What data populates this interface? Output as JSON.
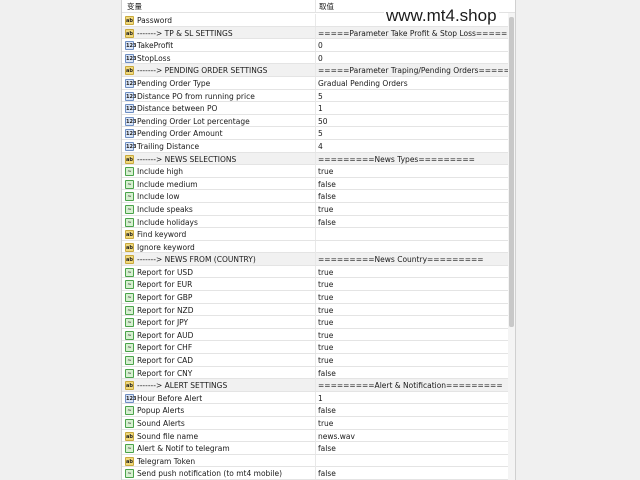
{
  "header": {
    "col_variable": "变量",
    "col_value": "取值"
  },
  "watermark": "www.mt4.shop",
  "rows": [
    {
      "icon": "ab",
      "name": "Password",
      "value": "",
      "sep": false
    },
    {
      "icon": "ab",
      "name": "-------> TP & SL SETTINGS",
      "value": "=====Parameter Take Profit & Stop Loss=====",
      "sep": true
    },
    {
      "icon": "n",
      "name": "TakeProfit",
      "value": "0",
      "sep": false
    },
    {
      "icon": "n",
      "name": "StopLoss",
      "value": "0",
      "sep": false
    },
    {
      "icon": "ab",
      "name": "-------> PENDING ORDER SETTINGS",
      "value": "=====Parameter Traping/Pending Orders=====",
      "sep": true
    },
    {
      "icon": "n",
      "name": "Pending Order Type",
      "value": "Gradual Pending Orders",
      "sep": false
    },
    {
      "icon": "n",
      "name": "Distance PO from running price",
      "value": "5",
      "sep": false
    },
    {
      "icon": "n",
      "name": "Distance between PO",
      "value": "1",
      "sep": false
    },
    {
      "icon": "n",
      "name": "Pending Order Lot percentage",
      "value": "50",
      "sep": false
    },
    {
      "icon": "n",
      "name": "Pending Order Amount",
      "value": "5",
      "sep": false
    },
    {
      "icon": "n",
      "name": "Trailing Distance",
      "value": "4",
      "sep": false
    },
    {
      "icon": "ab",
      "name": "-------> NEWS SELECTIONS",
      "value": "=========News Types=========",
      "sep": true
    },
    {
      "icon": "b",
      "name": "Include high",
      "value": "true",
      "sep": false
    },
    {
      "icon": "b",
      "name": "Include medium",
      "value": "false",
      "sep": false
    },
    {
      "icon": "b",
      "name": "Include low",
      "value": "false",
      "sep": false
    },
    {
      "icon": "b",
      "name": "Include speaks",
      "value": "true",
      "sep": false
    },
    {
      "icon": "b",
      "name": "Include holidays",
      "value": "false",
      "sep": false
    },
    {
      "icon": "ab",
      "name": "Find keyword",
      "value": "",
      "sep": false
    },
    {
      "icon": "ab",
      "name": "Ignore keyword",
      "value": "",
      "sep": false
    },
    {
      "icon": "ab",
      "name": "-------> NEWS FROM (COUNTRY)",
      "value": "=========News Country=========",
      "sep": true
    },
    {
      "icon": "b",
      "name": "Report for USD",
      "value": "true",
      "sep": false
    },
    {
      "icon": "b",
      "name": "Report for EUR",
      "value": "true",
      "sep": false
    },
    {
      "icon": "b",
      "name": "Report for GBP",
      "value": "true",
      "sep": false
    },
    {
      "icon": "b",
      "name": "Report for NZD",
      "value": "true",
      "sep": false
    },
    {
      "icon": "b",
      "name": "Report for JPY",
      "value": "true",
      "sep": false
    },
    {
      "icon": "b",
      "name": "Report for AUD",
      "value": "true",
      "sep": false
    },
    {
      "icon": "b",
      "name": "Report for CHF",
      "value": "true",
      "sep": false
    },
    {
      "icon": "b",
      "name": "Report for CAD",
      "value": "true",
      "sep": false
    },
    {
      "icon": "b",
      "name": "Report for CNY",
      "value": "false",
      "sep": false
    },
    {
      "icon": "ab",
      "name": "-------> ALERT SETTINGS",
      "value": "=========Alert & Notification=========",
      "sep": true
    },
    {
      "icon": "n",
      "name": "Hour Before Alert",
      "value": "1",
      "sep": false
    },
    {
      "icon": "b",
      "name": "Popup Alerts",
      "value": "false",
      "sep": false
    },
    {
      "icon": "b",
      "name": "Sound Alerts",
      "value": "true",
      "sep": false
    },
    {
      "icon": "ab",
      "name": "Sound file name",
      "value": "news.wav",
      "sep": false
    },
    {
      "icon": "b",
      "name": "Alert & Notif to telegram",
      "value": "false",
      "sep": false
    },
    {
      "icon": "ab",
      "name": "Telegram Token",
      "value": "",
      "sep": false
    },
    {
      "icon": "b",
      "name": "Send push notification (to mt4 mobile)",
      "value": "false",
      "sep": false
    }
  ],
  "icon_glyphs": {
    "ab": "ab",
    "n": "123",
    "b": "~"
  },
  "colors": {
    "string_icon": "#f1d97c",
    "number_icon": "#dbe6f7",
    "bool_icon": "#d6f0d0"
  }
}
